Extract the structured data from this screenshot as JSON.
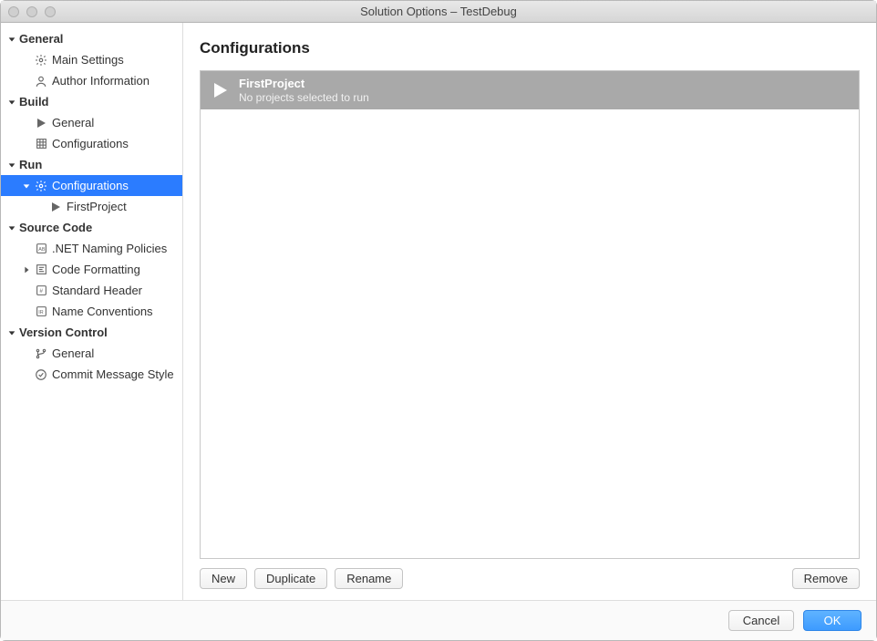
{
  "window": {
    "title": "Solution Options – TestDebug"
  },
  "sidebar": {
    "sections": [
      {
        "label": "General",
        "items": [
          {
            "label": "Main Settings",
            "icon": "gear"
          },
          {
            "label": "Author Information",
            "icon": "author"
          }
        ]
      },
      {
        "label": "Build",
        "items": [
          {
            "label": "General",
            "icon": "play-small"
          },
          {
            "label": "Configurations",
            "icon": "grid"
          }
        ]
      },
      {
        "label": "Run",
        "items": [
          {
            "label": "Configurations",
            "icon": "gear",
            "selected": true,
            "children": [
              {
                "label": "FirstProject",
                "icon": "play-small"
              }
            ]
          }
        ]
      },
      {
        "label": "Source Code",
        "items": [
          {
            "label": ".NET Naming Policies",
            "icon": "doc-ab"
          },
          {
            "label": "Code Formatting",
            "icon": "format",
            "expandable": true
          },
          {
            "label": "Standard Header",
            "icon": "doc-hash"
          },
          {
            "label": "Name Conventions",
            "icon": "doc-ir"
          }
        ]
      },
      {
        "label": "Version Control",
        "items": [
          {
            "label": "General",
            "icon": "branch"
          },
          {
            "label": "Commit Message Style",
            "icon": "check-circle"
          }
        ]
      }
    ]
  },
  "content": {
    "title": "Configurations",
    "items": [
      {
        "title": "FirstProject",
        "subtitle": "No projects selected to run"
      }
    ],
    "buttons": {
      "new": "New",
      "duplicate": "Duplicate",
      "rename": "Rename",
      "remove": "Remove"
    }
  },
  "footer": {
    "cancel": "Cancel",
    "ok": "OK"
  }
}
